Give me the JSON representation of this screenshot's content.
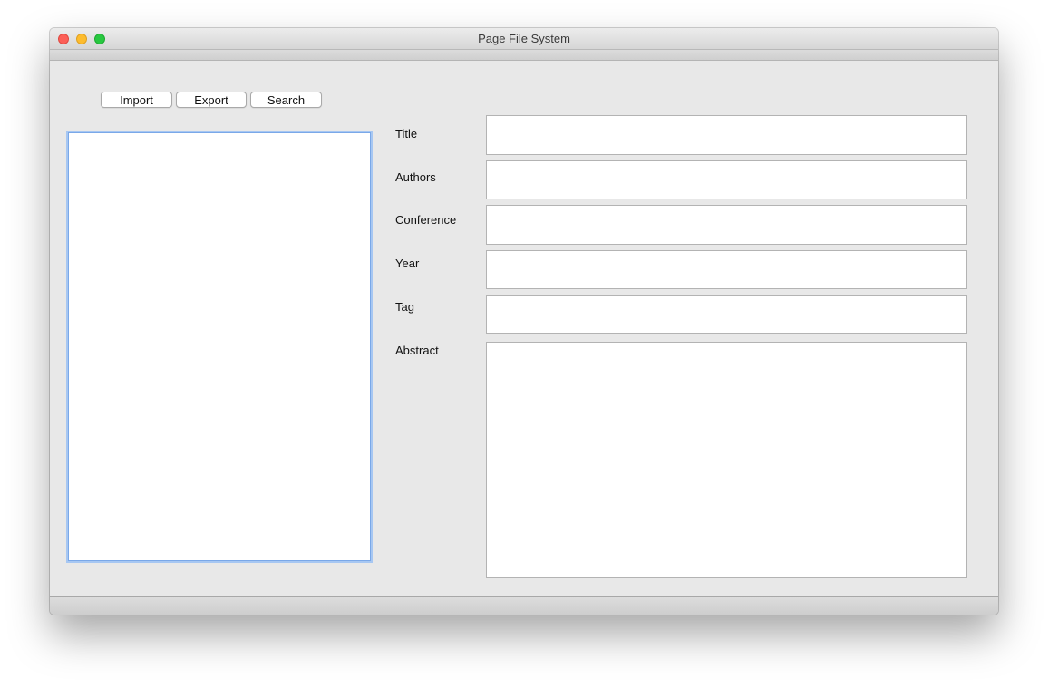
{
  "window": {
    "title": "Page File System"
  },
  "toolbar": {
    "import_label": "Import",
    "export_label": "Export",
    "search_label": "Search"
  },
  "form": {
    "title_label": "Title",
    "title_value": "",
    "authors_label": "Authors",
    "authors_value": "",
    "conference_label": "Conference",
    "conference_value": "",
    "year_label": "Year",
    "year_value": "",
    "tag_label": "Tag",
    "tag_value": "",
    "abstract_label": "Abstract",
    "abstract_value": ""
  },
  "colors": {
    "close": "#fc5f57",
    "minimize": "#fdbc2e",
    "zoom": "#28c840",
    "focus_ring": "#7aa8e8"
  }
}
